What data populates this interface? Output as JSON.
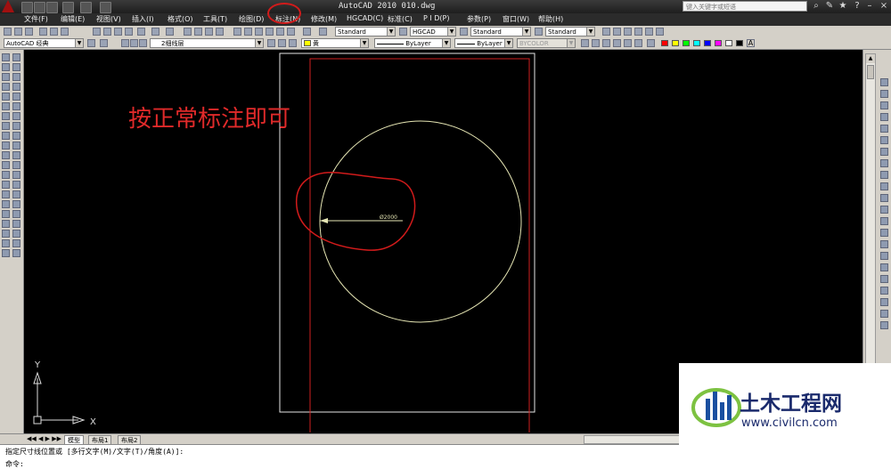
{
  "titlebar": {
    "title": "AutoCAD 2010   010.dwg",
    "search_placeholder": "键入关键字或短语"
  },
  "menubar": {
    "items": [
      "文件(F)",
      "编辑(E)",
      "视图(V)",
      "插入(I)",
      "格式(O)",
      "工具(T)",
      "绘图(D)",
      "标注(N)",
      "修改(M)",
      "HGCAD(C)",
      "标准(C)",
      "P I D(P)",
      "参数(P)",
      "窗口(W)",
      "帮助(H)"
    ],
    "highlighted": "标注(N)"
  },
  "toolbar1": {
    "text_style": "Standard",
    "dim_style": "HGCAD",
    "table_style": "Standard",
    "multileader_style": "Standard"
  },
  "toolbar2": {
    "workspace": "AutoCAD 经典",
    "layer": "2细线层",
    "color": "黄",
    "linetype": "ByLayer",
    "lineweight": "ByLayer",
    "plotstyle": "BYCOLOR"
  },
  "drawing": {
    "annotation": "按正常标注即可",
    "dimension_text": "Ø2000",
    "ucs_x": "X",
    "ucs_y": "Y"
  },
  "layout_tabs": [
    "模型",
    "布局1",
    "布局2"
  ],
  "command_line": {
    "prompt": "指定尺寸线位置或 [多行文字(M)/文字(T)/角度(A)]:",
    "input_label": "命令:"
  },
  "watermark": {
    "title": "土木工程网",
    "url": "www.civilcn.com"
  },
  "colors": {
    "annotation_red": "#e02a2a",
    "circle_yellow": "#e6e6b4",
    "menu_circle_red": "#d21b1b"
  }
}
